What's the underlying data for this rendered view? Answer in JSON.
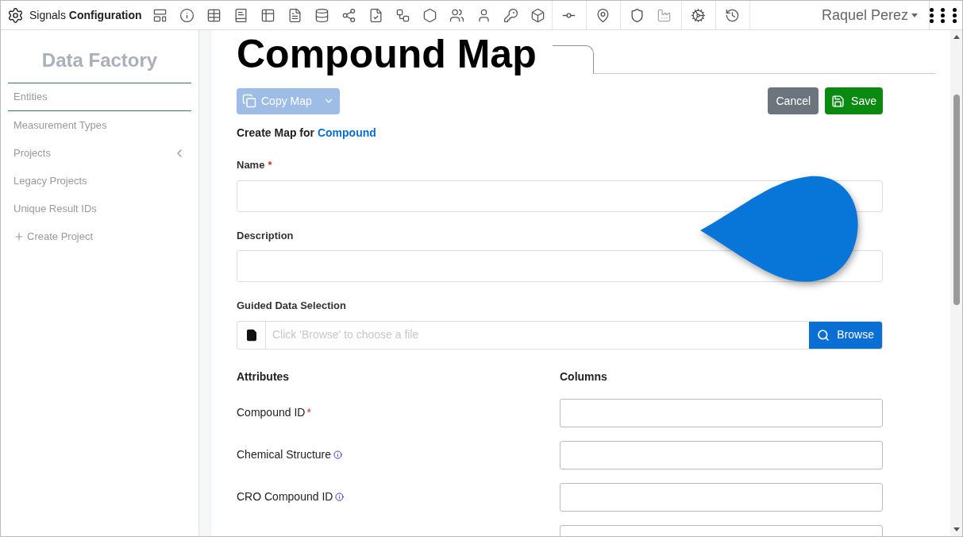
{
  "app": {
    "brand_light": "Signals",
    "brand_bold": "Configuration",
    "user": "Raquel Perez"
  },
  "sidebar": {
    "title": "Data Factory",
    "items": [
      {
        "label": "Entities",
        "selected": true,
        "kind": "link"
      },
      {
        "label": "Measurement Types",
        "selected": false,
        "kind": "link"
      },
      {
        "label": "Projects",
        "selected": false,
        "kind": "expandable"
      },
      {
        "label": "Legacy Projects",
        "selected": false,
        "kind": "link"
      },
      {
        "label": "Unique Result IDs",
        "selected": false,
        "kind": "link"
      },
      {
        "label": "Create Project",
        "selected": false,
        "kind": "action"
      }
    ]
  },
  "page": {
    "title": "Compound Map",
    "copy_button": {
      "label": "Copy Map",
      "disabled": true
    },
    "cancel_button": "Cancel",
    "save_button": "Save",
    "heading": {
      "text": "Create Map for",
      "entity": "Compound"
    },
    "required_mark": "*",
    "fields": [
      {
        "label": "Name",
        "required": true
      },
      {
        "label": "Description",
        "required": false
      }
    ],
    "guided": {
      "label": "Guided Data Selection",
      "placeholder": "Click 'Browse' to choose a file",
      "button": "Browse"
    },
    "attributes_header": "Attributes",
    "columns_header": "Columns",
    "attributes": [
      {
        "label": "Compound ID",
        "required": true,
        "info": false
      },
      {
        "label": "Chemical Structure",
        "required": false,
        "info": true
      },
      {
        "label": "CRO Compound ID",
        "required": false,
        "info": true
      }
    ]
  }
}
